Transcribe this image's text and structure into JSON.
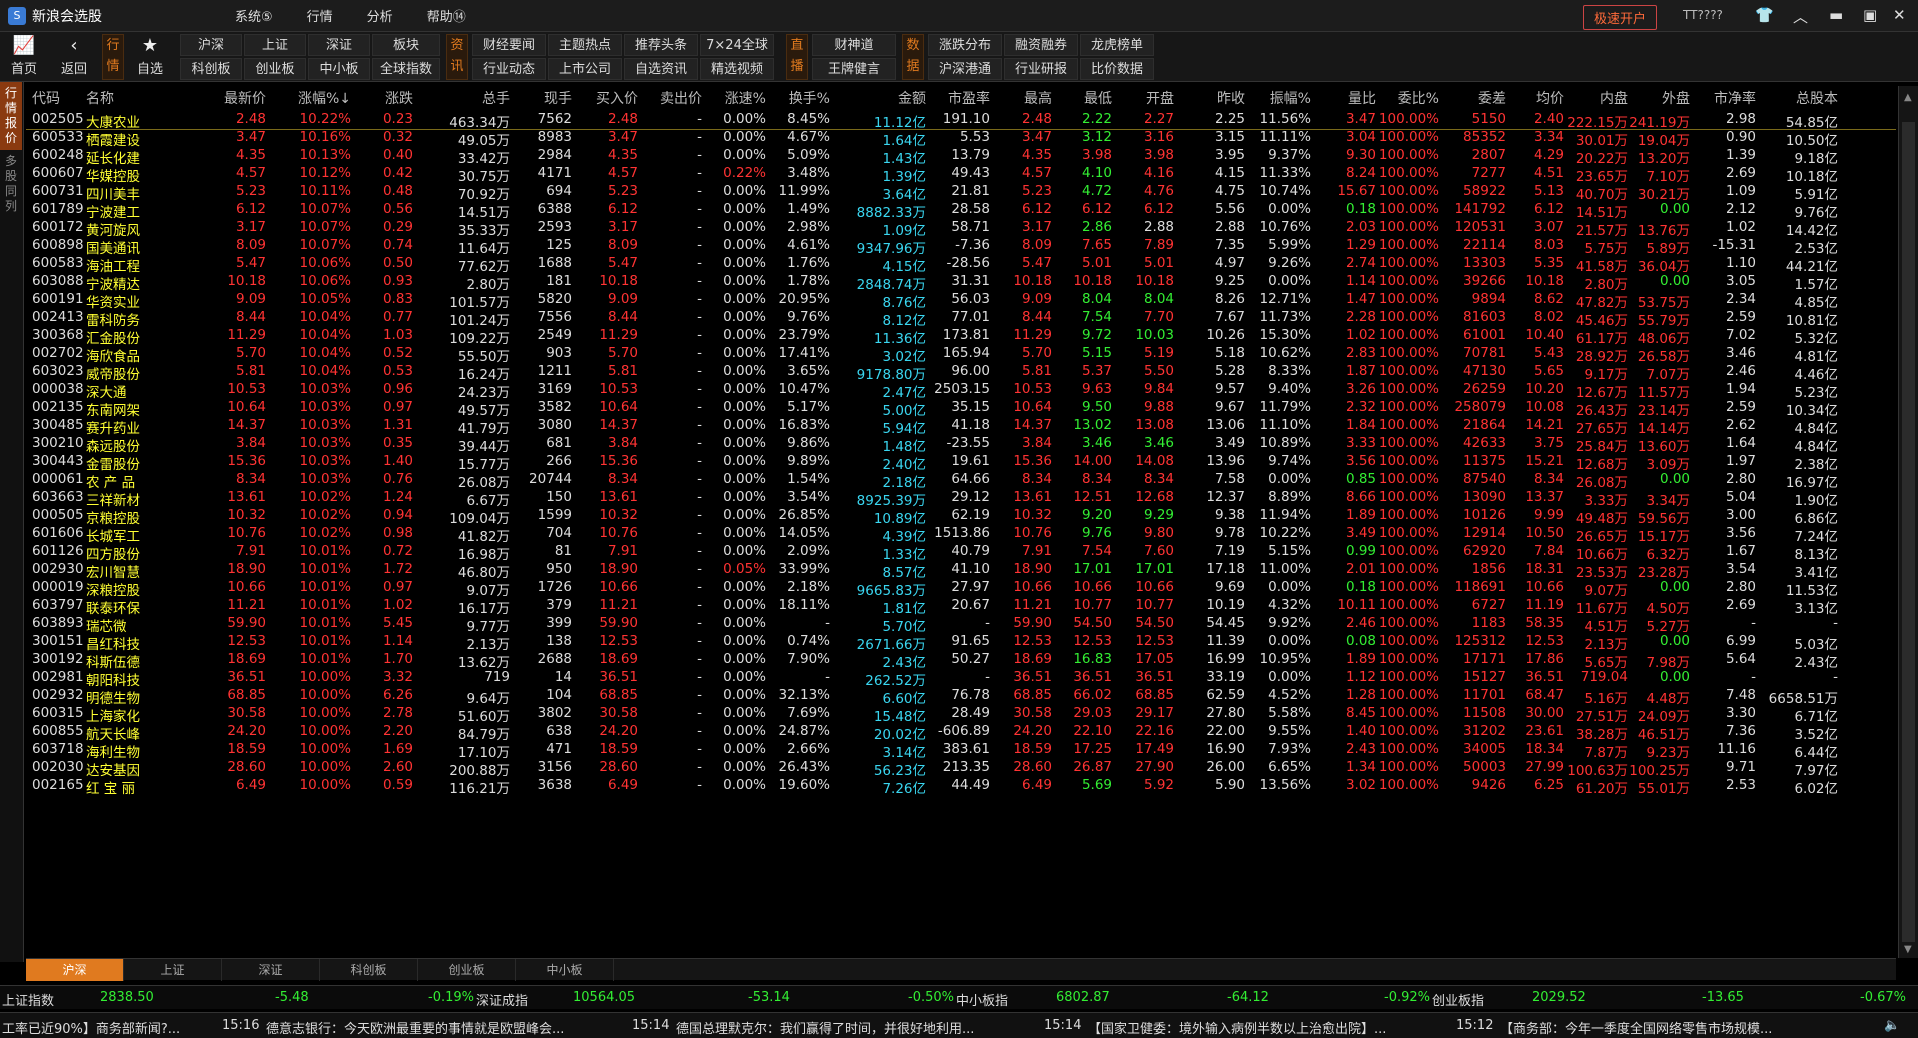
{
  "app": {
    "logo": "S",
    "title": "新浪会选股",
    "menu": [
      "系统⑤",
      "行情",
      "分析",
      "帮助⑭"
    ],
    "open_account": "极速开户",
    "user": "TT????"
  },
  "toolbar": {
    "home": "首页",
    "back": "返回",
    "favorite": "自选",
    "tag_market": "行情",
    "tag_info": "资讯",
    "tag_live": "直播",
    "tag_data": "数据",
    "market_buttons": [
      "沪深",
      "上证",
      "深证",
      "板块",
      "科创板",
      "创业板",
      "中小板",
      "全球指数"
    ],
    "info_buttons": [
      "财经要闻",
      "主题热点",
      "推荐头条",
      "7×24全球",
      "行业动态",
      "上市公司",
      "自选资讯",
      "精选视频"
    ],
    "live_buttons": [
      "财神道",
      "王牌健言"
    ],
    "data_buttons": [
      "涨跌分布",
      "融资融券",
      "龙虎榜单",
      "沪深港通",
      "行业研报",
      "比价数据"
    ]
  },
  "sidebar": {
    "active": "行情报价",
    "other": "多股同列"
  },
  "columns": [
    "代码",
    "名称",
    "最新价",
    "涨幅%↓",
    "涨跌",
    "总手",
    "现手",
    "买入价",
    "卖出价",
    "涨速%",
    "换手%",
    "金额",
    "市盈率",
    "最高",
    "最低",
    "开盘",
    "昨收",
    "振幅%",
    "量比",
    "委比%",
    "委差",
    "均价",
    "内盘",
    "外盘",
    "市净率",
    "总股本"
  ],
  "rows": [
    [
      "002505",
      "大康农业",
      "2.48",
      "10.22%",
      "0.23",
      "463.34万",
      "7562",
      "2.48",
      "-",
      "0.00%",
      "8.45%",
      "11.12亿",
      "191.10",
      "2.48",
      "2.22",
      "2.27",
      "2.25",
      "11.56%",
      "3.47",
      "100.00%",
      "5150",
      "2.40",
      "222.15万",
      "241.19万",
      "2.98",
      "54.85亿"
    ],
    [
      "600533",
      "栖霞建设",
      "3.47",
      "10.16%",
      "0.32",
      "49.05万",
      "8983",
      "3.47",
      "-",
      "0.00%",
      "4.67%",
      "1.64亿",
      "5.53",
      "3.47",
      "3.12",
      "3.16",
      "3.15",
      "11.11%",
      "3.04",
      "100.00%",
      "85352",
      "3.34",
      "30.01万",
      "19.04万",
      "0.90",
      "10.50亿"
    ],
    [
      "600248",
      "延长化建",
      "4.35",
      "10.13%",
      "0.40",
      "33.42万",
      "2984",
      "4.35",
      "-",
      "0.00%",
      "5.09%",
      "1.43亿",
      "13.79",
      "4.35",
      "3.98",
      "3.98",
      "3.95",
      "9.37%",
      "9.30",
      "100.00%",
      "2807",
      "4.29",
      "20.22万",
      "13.20万",
      "1.39",
      "9.18亿"
    ],
    [
      "600607",
      "华媒控股",
      "4.57",
      "10.12%",
      "0.42",
      "30.75万",
      "4171",
      "4.57",
      "-",
      "0.22%",
      "3.48%",
      "1.39亿",
      "49.43",
      "4.57",
      "4.10",
      "4.16",
      "4.15",
      "11.33%",
      "8.24",
      "100.00%",
      "7277",
      "4.51",
      "23.65万",
      "7.10万",
      "2.69",
      "10.18亿"
    ],
    [
      "600731",
      "四川美丰",
      "5.23",
      "10.11%",
      "0.48",
      "70.92万",
      "694",
      "5.23",
      "-",
      "0.00%",
      "11.99%",
      "3.64亿",
      "21.81",
      "5.23",
      "4.72",
      "4.76",
      "4.75",
      "10.74%",
      "15.67",
      "100.00%",
      "58922",
      "5.13",
      "40.70万",
      "30.21万",
      "1.09",
      "5.91亿"
    ],
    [
      "601789",
      "宁波建工",
      "6.12",
      "10.07%",
      "0.56",
      "14.51万",
      "6388",
      "6.12",
      "-",
      "0.00%",
      "1.49%",
      "8882.33万",
      "28.58",
      "6.12",
      "6.12",
      "6.12",
      "5.56",
      "0.00%",
      "0.18",
      "100.00%",
      "141792",
      "6.12",
      "14.51万",
      "0.00",
      "2.12",
      "9.76亿"
    ],
    [
      "600172",
      "黄河旋风",
      "3.17",
      "10.07%",
      "0.29",
      "35.33万",
      "2593",
      "3.17",
      "-",
      "0.00%",
      "2.98%",
      "1.09亿",
      "58.71",
      "3.17",
      "2.86",
      "2.88",
      "2.88",
      "10.76%",
      "2.03",
      "100.00%",
      "120531",
      "3.07",
      "21.57万",
      "13.76万",
      "1.02",
      "14.42亿"
    ],
    [
      "600898",
      "国美通讯",
      "8.09",
      "10.07%",
      "0.74",
      "11.64万",
      "125",
      "8.09",
      "-",
      "0.00%",
      "4.61%",
      "9347.96万",
      "-7.36",
      "8.09",
      "7.65",
      "7.89",
      "7.35",
      "5.99%",
      "1.29",
      "100.00%",
      "22114",
      "8.03",
      "5.75万",
      "5.89万",
      "-15.31",
      "2.53亿"
    ],
    [
      "600583",
      "海油工程",
      "5.47",
      "10.06%",
      "0.50",
      "77.62万",
      "1688",
      "5.47",
      "-",
      "0.00%",
      "1.76%",
      "4.15亿",
      "-28.56",
      "5.47",
      "5.01",
      "5.01",
      "4.97",
      "9.26%",
      "2.74",
      "100.00%",
      "13303",
      "5.35",
      "41.58万",
      "36.04万",
      "1.10",
      "44.21亿"
    ],
    [
      "603088",
      "宁波精达",
      "10.18",
      "10.06%",
      "0.93",
      "2.80万",
      "181",
      "10.18",
      "-",
      "0.00%",
      "1.78%",
      "2848.74万",
      "31.31",
      "10.18",
      "10.18",
      "10.18",
      "9.25",
      "0.00%",
      "1.14",
      "100.00%",
      "39266",
      "10.18",
      "2.80万",
      "0.00",
      "3.05",
      "1.57亿"
    ],
    [
      "600191",
      "华资实业",
      "9.09",
      "10.05%",
      "0.83",
      "101.57万",
      "5820",
      "9.09",
      "-",
      "0.00%",
      "20.95%",
      "8.76亿",
      "56.03",
      "9.09",
      "8.04",
      "8.04",
      "8.26",
      "12.71%",
      "1.47",
      "100.00%",
      "9894",
      "8.62",
      "47.82万",
      "53.75万",
      "2.34",
      "4.85亿"
    ],
    [
      "002413",
      "雷科防务",
      "8.44",
      "10.04%",
      "0.77",
      "101.24万",
      "7556",
      "8.44",
      "-",
      "0.00%",
      "9.76%",
      "8.12亿",
      "77.01",
      "8.44",
      "7.54",
      "7.70",
      "7.67",
      "11.73%",
      "2.28",
      "100.00%",
      "81603",
      "8.02",
      "45.46万",
      "55.79万",
      "2.59",
      "10.81亿"
    ],
    [
      "300368",
      "汇金股份",
      "11.29",
      "10.04%",
      "1.03",
      "109.22万",
      "2549",
      "11.29",
      "-",
      "0.00%",
      "23.79%",
      "11.36亿",
      "173.81",
      "11.29",
      "9.72",
      "10.03",
      "10.26",
      "15.30%",
      "1.02",
      "100.00%",
      "61001",
      "10.40",
      "61.17万",
      "48.06万",
      "7.02",
      "5.32亿"
    ],
    [
      "002702",
      "海欣食品",
      "5.70",
      "10.04%",
      "0.52",
      "55.50万",
      "903",
      "5.70",
      "-",
      "0.00%",
      "17.41%",
      "3.02亿",
      "165.94",
      "5.70",
      "5.15",
      "5.19",
      "5.18",
      "10.62%",
      "2.83",
      "100.00%",
      "70781",
      "5.43",
      "28.92万",
      "26.58万",
      "3.46",
      "4.81亿"
    ],
    [
      "603023",
      "威帝股份",
      "5.81",
      "10.04%",
      "0.53",
      "16.24万",
      "1211",
      "5.81",
      "-",
      "0.00%",
      "3.65%",
      "9178.80万",
      "96.00",
      "5.81",
      "5.37",
      "5.50",
      "5.28",
      "8.33%",
      "1.87",
      "100.00%",
      "47130",
      "5.65",
      "9.17万",
      "7.07万",
      "2.46",
      "4.46亿"
    ],
    [
      "000038",
      "深大通",
      "10.53",
      "10.03%",
      "0.96",
      "24.23万",
      "3169",
      "10.53",
      "-",
      "0.00%",
      "10.47%",
      "2.47亿",
      "2503.15",
      "10.53",
      "9.63",
      "9.84",
      "9.57",
      "9.40%",
      "3.26",
      "100.00%",
      "26259",
      "10.20",
      "12.67万",
      "11.57万",
      "1.94",
      "5.23亿"
    ],
    [
      "002135",
      "东南网架",
      "10.64",
      "10.03%",
      "0.97",
      "49.57万",
      "3582",
      "10.64",
      "-",
      "0.00%",
      "5.17%",
      "5.00亿",
      "35.15",
      "10.64",
      "9.50",
      "9.88",
      "9.67",
      "11.79%",
      "2.32",
      "100.00%",
      "258079",
      "10.08",
      "26.43万",
      "23.14万",
      "2.59",
      "10.34亿"
    ],
    [
      "300485",
      "赛升药业",
      "14.37",
      "10.03%",
      "1.31",
      "41.79万",
      "3080",
      "14.37",
      "-",
      "0.00%",
      "16.83%",
      "5.94亿",
      "41.18",
      "14.37",
      "13.02",
      "13.08",
      "13.06",
      "11.10%",
      "1.84",
      "100.00%",
      "21864",
      "14.21",
      "27.65万",
      "14.14万",
      "2.62",
      "4.84亿"
    ],
    [
      "300210",
      "森远股份",
      "3.84",
      "10.03%",
      "0.35",
      "39.44万",
      "681",
      "3.84",
      "-",
      "0.00%",
      "9.86%",
      "1.48亿",
      "-23.55",
      "3.84",
      "3.46",
      "3.46",
      "3.49",
      "10.89%",
      "3.33",
      "100.00%",
      "42633",
      "3.75",
      "25.84万",
      "13.60万",
      "1.64",
      "4.84亿"
    ],
    [
      "300443",
      "金雷股份",
      "15.36",
      "10.03%",
      "1.40",
      "15.77万",
      "266",
      "15.36",
      "-",
      "0.00%",
      "9.89%",
      "2.40亿",
      "19.61",
      "15.36",
      "14.00",
      "14.08",
      "13.96",
      "9.74%",
      "3.56",
      "100.00%",
      "11375",
      "15.21",
      "12.68万",
      "3.09万",
      "1.97",
      "2.38亿"
    ],
    [
      "000061",
      "农 产 品",
      "8.34",
      "10.03%",
      "0.76",
      "26.08万",
      "20744",
      "8.34",
      "-",
      "0.00%",
      "1.54%",
      "2.18亿",
      "64.66",
      "8.34",
      "8.34",
      "8.34",
      "7.58",
      "0.00%",
      "0.85",
      "100.00%",
      "87540",
      "8.34",
      "26.08万",
      "0.00",
      "2.80",
      "16.97亿"
    ],
    [
      "603663",
      "三祥新材",
      "13.61",
      "10.02%",
      "1.24",
      "6.67万",
      "150",
      "13.61",
      "-",
      "0.00%",
      "3.54%",
      "8925.39万",
      "29.12",
      "13.61",
      "12.51",
      "12.68",
      "12.37",
      "8.89%",
      "8.66",
      "100.00%",
      "13090",
      "13.37",
      "3.33万",
      "3.34万",
      "5.04",
      "1.90亿"
    ],
    [
      "000505",
      "京粮控股",
      "10.32",
      "10.02%",
      "0.94",
      "109.04万",
      "1599",
      "10.32",
      "-",
      "0.00%",
      "26.85%",
      "10.89亿",
      "62.19",
      "10.32",
      "9.20",
      "9.29",
      "9.38",
      "11.94%",
      "1.89",
      "100.00%",
      "10126",
      "9.99",
      "49.48万",
      "59.56万",
      "3.00",
      "6.86亿"
    ],
    [
      "601606",
      "长城军工",
      "10.76",
      "10.02%",
      "0.98",
      "41.82万",
      "704",
      "10.76",
      "-",
      "0.00%",
      "14.05%",
      "4.39亿",
      "1513.86",
      "10.76",
      "9.76",
      "9.80",
      "9.78",
      "10.22%",
      "3.49",
      "100.00%",
      "12914",
      "10.50",
      "26.65万",
      "15.17万",
      "3.56",
      "7.24亿"
    ],
    [
      "601126",
      "四方股份",
      "7.91",
      "10.01%",
      "0.72",
      "16.98万",
      "81",
      "7.91",
      "-",
      "0.00%",
      "2.09%",
      "1.33亿",
      "40.79",
      "7.91",
      "7.54",
      "7.60",
      "7.19",
      "5.15%",
      "0.99",
      "100.00%",
      "62920",
      "7.84",
      "10.66万",
      "6.32万",
      "1.67",
      "8.13亿"
    ],
    [
      "002930",
      "宏川智慧",
      "18.90",
      "10.01%",
      "1.72",
      "46.80万",
      "950",
      "18.90",
      "-",
      "0.05%",
      "33.99%",
      "8.57亿",
      "41.10",
      "18.90",
      "17.01",
      "17.01",
      "17.18",
      "11.00%",
      "2.01",
      "100.00%",
      "1856",
      "18.31",
      "23.53万",
      "23.28万",
      "3.54",
      "3.41亿"
    ],
    [
      "000019",
      "深粮控股",
      "10.66",
      "10.01%",
      "0.97",
      "9.07万",
      "1726",
      "10.66",
      "-",
      "0.00%",
      "2.18%",
      "9665.83万",
      "27.97",
      "10.66",
      "10.66",
      "10.66",
      "9.69",
      "0.00%",
      "0.18",
      "100.00%",
      "118691",
      "10.66",
      "9.07万",
      "0.00",
      "2.80",
      "11.53亿"
    ],
    [
      "603797",
      "联泰环保",
      "11.21",
      "10.01%",
      "1.02",
      "16.17万",
      "379",
      "11.21",
      "-",
      "0.00%",
      "18.11%",
      "1.81亿",
      "20.67",
      "11.21",
      "10.77",
      "10.77",
      "10.19",
      "4.32%",
      "10.11",
      "100.00%",
      "6727",
      "11.19",
      "11.67万",
      "4.50万",
      "2.69",
      "3.13亿"
    ],
    [
      "603893",
      "瑞芯微",
      "59.90",
      "10.01%",
      "5.45",
      "9.77万",
      "399",
      "59.90",
      "-",
      "0.00%",
      "-",
      "5.70亿",
      "-",
      "59.90",
      "54.50",
      "54.50",
      "54.45",
      "9.92%",
      "2.46",
      "100.00%",
      "1183",
      "58.35",
      "4.51万",
      "5.27万",
      "-",
      "-"
    ],
    [
      "300151",
      "昌红科技",
      "12.53",
      "10.01%",
      "1.14",
      "2.13万",
      "138",
      "12.53",
      "-",
      "0.00%",
      "0.74%",
      "2671.66万",
      "91.65",
      "12.53",
      "12.53",
      "12.53",
      "11.39",
      "0.00%",
      "0.08",
      "100.00%",
      "125312",
      "12.53",
      "2.13万",
      "0.00",
      "6.99",
      "5.03亿"
    ],
    [
      "300192",
      "科斯伍德",
      "18.69",
      "10.01%",
      "1.70",
      "13.62万",
      "2688",
      "18.69",
      "-",
      "0.00%",
      "7.90%",
      "2.43亿",
      "50.27",
      "18.69",
      "16.83",
      "17.05",
      "16.99",
      "10.95%",
      "1.89",
      "100.00%",
      "17171",
      "17.86",
      "5.65万",
      "7.98万",
      "5.64",
      "2.43亿"
    ],
    [
      "002981",
      "朝阳科技",
      "36.51",
      "10.00%",
      "3.32",
      "719",
      "14",
      "36.51",
      "-",
      "0.00%",
      "-",
      "262.52万",
      "-",
      "36.51",
      "36.51",
      "36.51",
      "33.19",
      "0.00%",
      "1.12",
      "100.00%",
      "15127",
      "36.51",
      "719.04",
      "0.00",
      "-",
      "-"
    ],
    [
      "002932",
      "明德生物",
      "68.85",
      "10.00%",
      "6.26",
      "9.64万",
      "104",
      "68.85",
      "-",
      "0.00%",
      "32.13%",
      "6.60亿",
      "76.78",
      "68.85",
      "66.02",
      "68.85",
      "62.59",
      "4.52%",
      "1.28",
      "100.00%",
      "11701",
      "68.47",
      "5.16万",
      "4.48万",
      "7.48",
      "6658.51万"
    ],
    [
      "600315",
      "上海家化",
      "30.58",
      "10.00%",
      "2.78",
      "51.60万",
      "3802",
      "30.58",
      "-",
      "0.00%",
      "7.69%",
      "15.48亿",
      "28.49",
      "30.58",
      "29.03",
      "29.17",
      "27.80",
      "5.58%",
      "8.45",
      "100.00%",
      "11508",
      "30.00",
      "27.51万",
      "24.09万",
      "3.30",
      "6.71亿"
    ],
    [
      "600855",
      "航天长峰",
      "24.20",
      "10.00%",
      "2.20",
      "84.79万",
      "638",
      "24.20",
      "-",
      "0.00%",
      "24.87%",
      "20.02亿",
      "-606.89",
      "24.20",
      "22.10",
      "22.16",
      "22.00",
      "9.55%",
      "1.40",
      "100.00%",
      "31202",
      "23.61",
      "38.28万",
      "46.51万",
      "7.36",
      "3.52亿"
    ],
    [
      "603718",
      "海利生物",
      "18.59",
      "10.00%",
      "1.69",
      "17.10万",
      "471",
      "18.59",
      "-",
      "0.00%",
      "2.66%",
      "3.14亿",
      "383.61",
      "18.59",
      "17.25",
      "17.49",
      "16.90",
      "7.93%",
      "2.43",
      "100.00%",
      "34005",
      "18.34",
      "7.87万",
      "9.23万",
      "11.16",
      "6.44亿"
    ],
    [
      "002030",
      "达安基因",
      "28.60",
      "10.00%",
      "2.60",
      "200.88万",
      "3156",
      "28.60",
      "-",
      "0.00%",
      "26.43%",
      "56.23亿",
      "213.35",
      "28.60",
      "26.87",
      "27.90",
      "26.00",
      "6.65%",
      "1.34",
      "100.00%",
      "50003",
      "27.99",
      "100.63万",
      "100.25万",
      "9.71",
      "7.97亿"
    ],
    [
      "002165",
      "红 宝 丽",
      "6.49",
      "10.00%",
      "0.59",
      "116.21万",
      "3638",
      "6.49",
      "-",
      "0.00%",
      "19.60%",
      "7.26亿",
      "44.49",
      "6.49",
      "5.69",
      "5.92",
      "5.90",
      "13.56%",
      "3.02",
      "100.00%",
      "9426",
      "6.25",
      "61.20万",
      "55.01万",
      "2.53",
      "6.02亿"
    ]
  ],
  "bottom_tabs": [
    "沪深",
    "上证",
    "深证",
    "科创板",
    "创业板",
    "中小板"
  ],
  "indices": [
    {
      "name": "上证指数",
      "value": "2838.50",
      "change": "-5.48",
      "pct": "-0.19%"
    },
    {
      "name": "深证成指",
      "value": "10564.05",
      "change": "-53.14",
      "pct": "-0.50%"
    },
    {
      "name": "中小板指",
      "value": "6802.87",
      "change": "-64.12",
      "pct": "-0.92%"
    },
    {
      "name": "创业板指",
      "value": "2029.52",
      "change": "-13.65",
      "pct": "-0.67%"
    }
  ],
  "news": [
    {
      "time": "",
      "text": "工率已近90%】商务部新闻?..."
    },
    {
      "time": "15:16",
      "text": "德意志银行：今天欧洲最重要的事情就是欧盟峰会..."
    },
    {
      "time": "15:14",
      "text": "德国总理默克尔：我们赢得了时间，并很好地利用..."
    },
    {
      "time": "15:14",
      "text": "【国家卫健委：境外输入病例半数以上治愈出院】..."
    },
    {
      "time": "15:12",
      "text": "【商务部：今年一季度全国网络零售市场规模..."
    }
  ],
  "colors": {
    "up": "#ff3333",
    "down": "#33ee33",
    "flat": "#dddddd",
    "code": "#dddddd",
    "name": "#ffff33",
    "amount": "#3ad6f0",
    "accent": "#e07a1f"
  }
}
